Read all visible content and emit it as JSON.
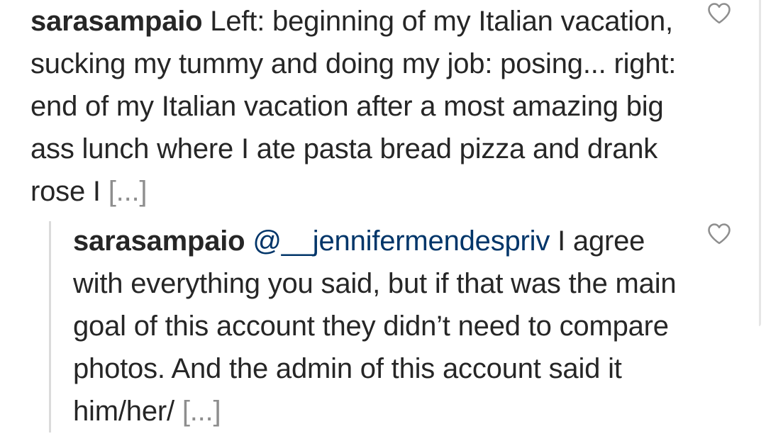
{
  "comments": [
    {
      "username": "sarasampaio",
      "text": " Left: beginning of my Italian vacation, sucking my tummy and doing my job: posing... right: end of my Italian vacation after a most amazing big ass lunch where I ate pasta bread pizza and drank rose I ",
      "more_label": "[...]",
      "like_icon": "heart-outline-icon"
    },
    {
      "username": "sarasampaio",
      "mention": "@__jennifermendespriv",
      "text": " I agree with everything you said, but if that was the main goal of this account they didn’t need to compare photos. And the admin of this account said it him/her/ ",
      "more_label": "[...]",
      "like_icon": "heart-outline-icon"
    }
  ],
  "colors": {
    "text": "#262626",
    "mention": "#003569",
    "muted": "#8e8e8e",
    "thread_line": "#dbdbdb",
    "icon": "#8e8e8e"
  }
}
